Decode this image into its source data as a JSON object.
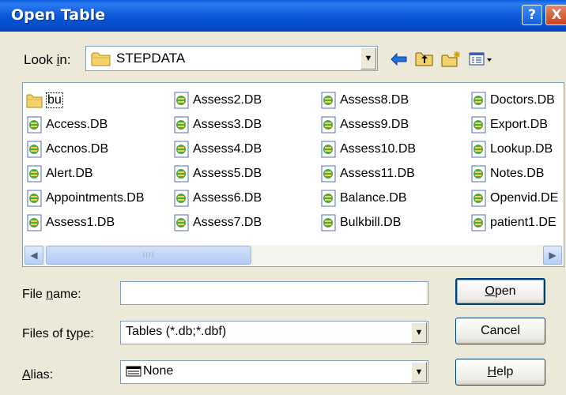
{
  "window": {
    "title": "Open Table",
    "help_btn": "?",
    "close_btn": "X"
  },
  "lookin": {
    "label_pre": "Look ",
    "label_u": "i",
    "label_post": "n:",
    "value": "STEPDATA",
    "arrow": "▼"
  },
  "toolbar": {
    "back_icon": "left-arrow-icon",
    "up_icon": "up-folder-icon",
    "newfolder_icon": "new-folder-icon",
    "views_icon": "view-menu-icon"
  },
  "files": {
    "col1": [
      "bu",
      "Access.DB",
      "Accnos.DB",
      "Alert.DB",
      "Appointments.DB",
      "Assess1.DB"
    ],
    "col2": [
      "Assess2.DB",
      "Assess3.DB",
      "Assess4.DB",
      "Assess5.DB",
      "Assess6.DB",
      "Assess7.DB"
    ],
    "col3": [
      "Assess8.DB",
      "Assess9.DB",
      "Assess10.DB",
      "Assess11.DB",
      "Balance.DB",
      "Bulkbill.DB"
    ],
    "col4": [
      "Doctors.DB",
      "Export.DB",
      "Lookup.DB",
      "Notes.DB",
      "Openvid.DE",
      "patient1.DE"
    ],
    "scroll_grip": "IIII"
  },
  "filename": {
    "label_pre": "File ",
    "label_u": "n",
    "label_post": "ame:",
    "value": ""
  },
  "filetype": {
    "label_pre": "Files of ",
    "label_u": "t",
    "label_post": "ype:",
    "value": "Tables (*.db;*.dbf)"
  },
  "alias": {
    "label_u": "A",
    "label_post": "lias:",
    "value": "None"
  },
  "buttons": {
    "open_u": "O",
    "open_post": "pen",
    "cancel": "Cancel",
    "help_u": "H",
    "help_post": "elp"
  },
  "colors": {
    "titlebar": "#0a58d8",
    "dialog_bg": "#ece9d8",
    "field_border": "#7f9db9"
  }
}
